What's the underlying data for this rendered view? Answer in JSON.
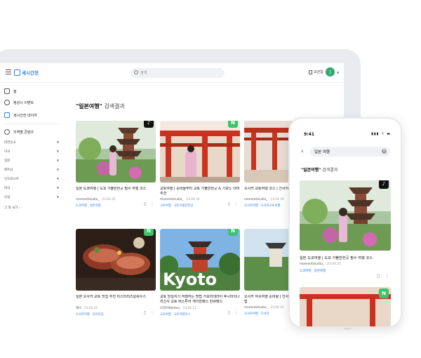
{
  "app": {
    "logo_text": "세시간전"
  },
  "topbar": {
    "search_placeholder": "검색",
    "save_label": "보관함",
    "avatar_initial": "J"
  },
  "sidebar": {
    "home": "홈",
    "event": "청성시 이벤트",
    "my_content": "세시간전 네이처",
    "region": "지역별 콘텐츠",
    "countries": [
      "대한민국",
      "미국",
      "일본",
      "베트남",
      "인도네시아",
      "태국",
      "유럽"
    ],
    "more": "그 외 국가"
  },
  "main": {
    "query": "\"일본여행\"",
    "result_suffix": "검색결과"
  },
  "cards": [
    {
      "title": "일본 도쿄여행 | 도쿄 가볼만한곳 필수 여행 코스",
      "author": "momentstudio_",
      "date": "23.04.25",
      "tags": [
        "도쿄여행",
        "일본여행"
      ],
      "badge": "tiktok"
    },
    {
      "title": "교토여행 | 준비물부터 교토 가볼만한곳 & 기모노 대여 추천",
      "author": "momentstudio_",
      "date": "23.04.24",
      "tags": [
        "교토여행",
        "교토가볼만한곳"
      ],
      "badge": "N"
    },
    {
      "title": "오사카 교토여행 코스 | 간사이 스루패스 예약",
      "author": "momentstudio_",
      "date": "23.04.19",
      "tags": [
        "오사카여행",
        "오사카교토여행"
      ],
      "badge": "N"
    },
    {
      "title": "일본 오사카 교토 맛집 추천 미스터리즈칼워우스",
      "author": "혜나",
      "date": "23.04.22",
      "tags": [
        "오사카여행",
        "교토맛집"
      ],
      "badge": "N"
    },
    {
      "title": "교토 당일치기 여행하는 방법 가모미데라이 후시미이나리신사 교토 버스투어 게이한패스 한큐패스",
      "author": "모먼트Mortery",
      "date": "23.04.12",
      "tags": [
        "교토여행",
        "교토여행코스"
      ],
      "badge": "N"
    },
    {
      "title": "오사카 자유여행 준비물 | 간사이 공항에서 시내 가는 법",
      "author": "momentstudio_",
      "date": "23.04.10",
      "tags": [
        "오사카여행",
        "오사카"
      ],
      "badge": "N"
    }
  ],
  "phone": {
    "time": "9:41",
    "status": "▮▮▮ ⌔ ▬",
    "search_value": "일본 여행",
    "query": "\"일본여행\"",
    "result_suffix": "검색결과",
    "card": {
      "title": "일본 도쿄여행 | 도쿄 가볼만한곳 필수 여행 코스",
      "author": "momentstudio_",
      "date": "23.04.25",
      "tags": [
        "도쿄여행",
        "일본여행"
      ]
    }
  },
  "colors": {
    "accent": "#2b7de9",
    "naver_green": "#3ec26b",
    "tiktok_black": "#111111"
  }
}
